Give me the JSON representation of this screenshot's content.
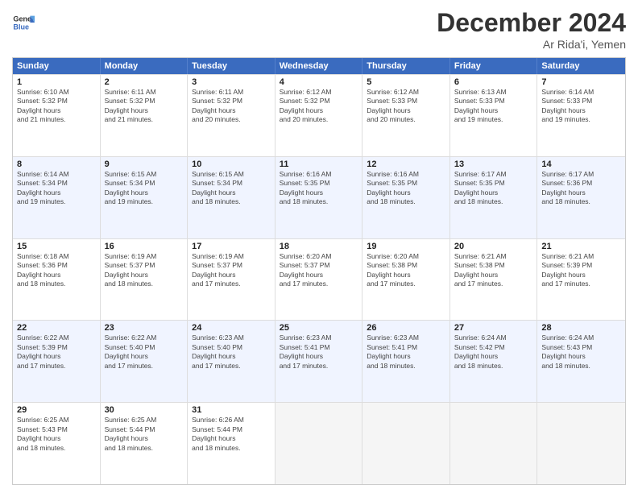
{
  "logo": {
    "text_general": "General",
    "text_blue": "Blue"
  },
  "title": "December 2024",
  "subtitle": "Ar Rida'i, Yemen",
  "days_of_week": [
    "Sunday",
    "Monday",
    "Tuesday",
    "Wednesday",
    "Thursday",
    "Friday",
    "Saturday"
  ],
  "weeks": [
    {
      "alt": false,
      "cells": [
        {
          "day": 1,
          "sunrise": "6:10 AM",
          "sunset": "5:32 PM",
          "daylight": "11 hours and 21 minutes."
        },
        {
          "day": 2,
          "sunrise": "6:11 AM",
          "sunset": "5:32 PM",
          "daylight": "11 hours and 21 minutes."
        },
        {
          "day": 3,
          "sunrise": "6:11 AM",
          "sunset": "5:32 PM",
          "daylight": "11 hours and 20 minutes."
        },
        {
          "day": 4,
          "sunrise": "6:12 AM",
          "sunset": "5:32 PM",
          "daylight": "11 hours and 20 minutes."
        },
        {
          "day": 5,
          "sunrise": "6:12 AM",
          "sunset": "5:33 PM",
          "daylight": "11 hours and 20 minutes."
        },
        {
          "day": 6,
          "sunrise": "6:13 AM",
          "sunset": "5:33 PM",
          "daylight": "11 hours and 19 minutes."
        },
        {
          "day": 7,
          "sunrise": "6:14 AM",
          "sunset": "5:33 PM",
          "daylight": "11 hours and 19 minutes."
        }
      ]
    },
    {
      "alt": true,
      "cells": [
        {
          "day": 8,
          "sunrise": "6:14 AM",
          "sunset": "5:34 PM",
          "daylight": "11 hours and 19 minutes."
        },
        {
          "day": 9,
          "sunrise": "6:15 AM",
          "sunset": "5:34 PM",
          "daylight": "11 hours and 19 minutes."
        },
        {
          "day": 10,
          "sunrise": "6:15 AM",
          "sunset": "5:34 PM",
          "daylight": "11 hours and 18 minutes."
        },
        {
          "day": 11,
          "sunrise": "6:16 AM",
          "sunset": "5:35 PM",
          "daylight": "11 hours and 18 minutes."
        },
        {
          "day": 12,
          "sunrise": "6:16 AM",
          "sunset": "5:35 PM",
          "daylight": "11 hours and 18 minutes."
        },
        {
          "day": 13,
          "sunrise": "6:17 AM",
          "sunset": "5:35 PM",
          "daylight": "11 hours and 18 minutes."
        },
        {
          "day": 14,
          "sunrise": "6:17 AM",
          "sunset": "5:36 PM",
          "daylight": "11 hours and 18 minutes."
        }
      ]
    },
    {
      "alt": false,
      "cells": [
        {
          "day": 15,
          "sunrise": "6:18 AM",
          "sunset": "5:36 PM",
          "daylight": "11 hours and 18 minutes."
        },
        {
          "day": 16,
          "sunrise": "6:19 AM",
          "sunset": "5:37 PM",
          "daylight": "11 hours and 18 minutes."
        },
        {
          "day": 17,
          "sunrise": "6:19 AM",
          "sunset": "5:37 PM",
          "daylight": "11 hours and 17 minutes."
        },
        {
          "day": 18,
          "sunrise": "6:20 AM",
          "sunset": "5:37 PM",
          "daylight": "11 hours and 17 minutes."
        },
        {
          "day": 19,
          "sunrise": "6:20 AM",
          "sunset": "5:38 PM",
          "daylight": "11 hours and 17 minutes."
        },
        {
          "day": 20,
          "sunrise": "6:21 AM",
          "sunset": "5:38 PM",
          "daylight": "11 hours and 17 minutes."
        },
        {
          "day": 21,
          "sunrise": "6:21 AM",
          "sunset": "5:39 PM",
          "daylight": "11 hours and 17 minutes."
        }
      ]
    },
    {
      "alt": true,
      "cells": [
        {
          "day": 22,
          "sunrise": "6:22 AM",
          "sunset": "5:39 PM",
          "daylight": "11 hours and 17 minutes."
        },
        {
          "day": 23,
          "sunrise": "6:22 AM",
          "sunset": "5:40 PM",
          "daylight": "11 hours and 17 minutes."
        },
        {
          "day": 24,
          "sunrise": "6:23 AM",
          "sunset": "5:40 PM",
          "daylight": "11 hours and 17 minutes."
        },
        {
          "day": 25,
          "sunrise": "6:23 AM",
          "sunset": "5:41 PM",
          "daylight": "11 hours and 17 minutes."
        },
        {
          "day": 26,
          "sunrise": "6:23 AM",
          "sunset": "5:41 PM",
          "daylight": "11 hours and 18 minutes."
        },
        {
          "day": 27,
          "sunrise": "6:24 AM",
          "sunset": "5:42 PM",
          "daylight": "11 hours and 18 minutes."
        },
        {
          "day": 28,
          "sunrise": "6:24 AM",
          "sunset": "5:43 PM",
          "daylight": "11 hours and 18 minutes."
        }
      ]
    },
    {
      "alt": false,
      "cells": [
        {
          "day": 29,
          "sunrise": "6:25 AM",
          "sunset": "5:43 PM",
          "daylight": "11 hours and 18 minutes."
        },
        {
          "day": 30,
          "sunrise": "6:25 AM",
          "sunset": "5:44 PM",
          "daylight": "11 hours and 18 minutes."
        },
        {
          "day": 31,
          "sunrise": "6:26 AM",
          "sunset": "5:44 PM",
          "daylight": "11 hours and 18 minutes."
        },
        null,
        null,
        null,
        null
      ]
    }
  ]
}
